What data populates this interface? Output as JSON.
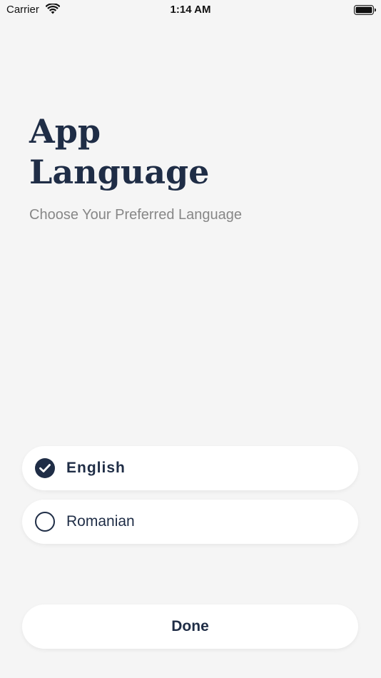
{
  "status_bar": {
    "carrier": "Carrier",
    "time": "1:14 AM",
    "wifi_icon": "wifi-icon",
    "battery_icon": "battery-icon"
  },
  "header": {
    "title": "App\nLanguage",
    "subtitle": "Choose Your Preferred Language"
  },
  "languages": {
    "options": [
      {
        "label": "English",
        "selected": true
      },
      {
        "label": "Romanian",
        "selected": false
      }
    ]
  },
  "actions": {
    "done_label": "Done"
  },
  "colors": {
    "background": "#f5f5f5",
    "primary": "#1f2d46",
    "subtitle": "#878787",
    "card": "#ffffff"
  }
}
